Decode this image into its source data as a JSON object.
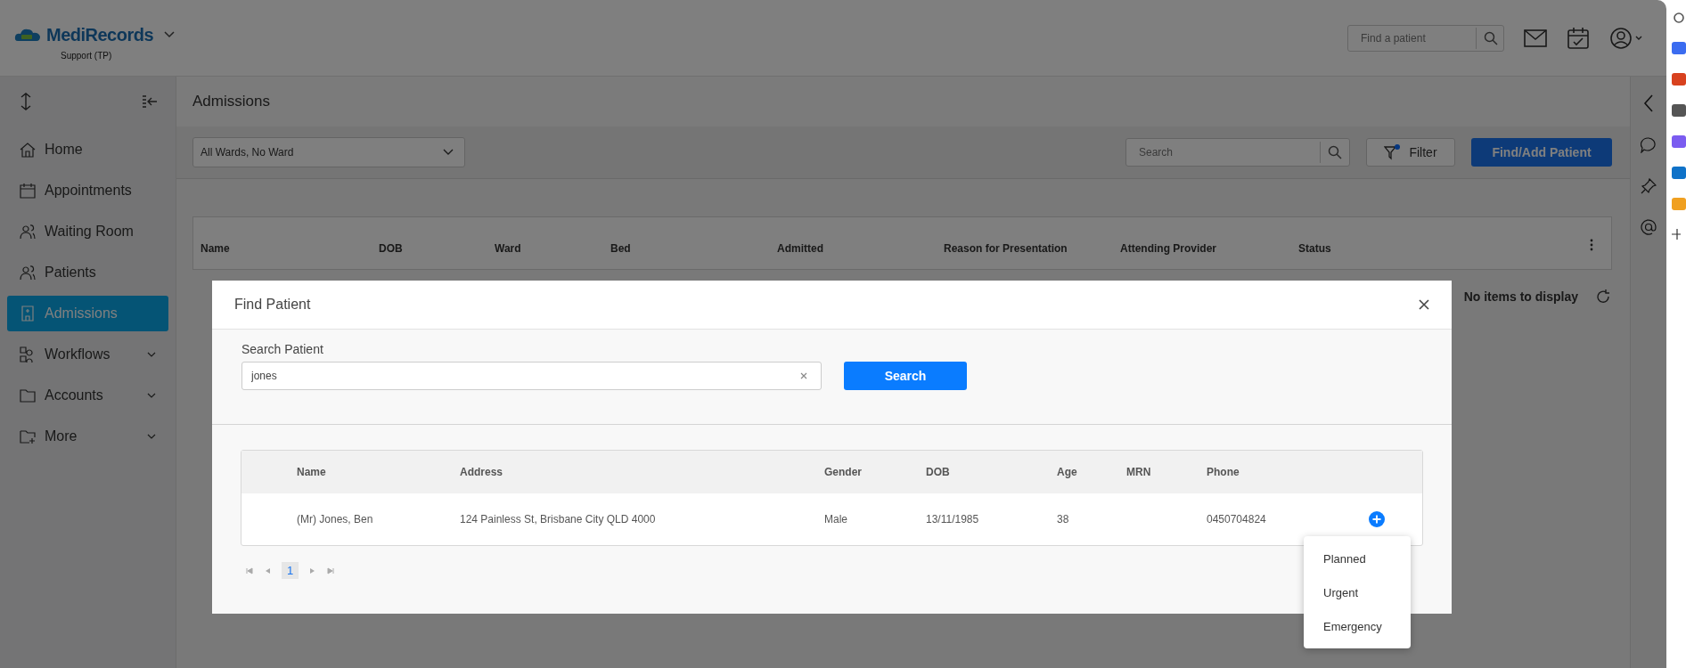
{
  "header": {
    "logo": "MediRecords",
    "subtitle": "Support (TP)",
    "search_placeholder": "Find a patient"
  },
  "sidebar": {
    "items": [
      {
        "label": "Home",
        "selected": false,
        "expandable": false
      },
      {
        "label": "Appointments",
        "selected": false,
        "expandable": false
      },
      {
        "label": "Waiting Room",
        "selected": false,
        "expandable": false
      },
      {
        "label": "Patients",
        "selected": false,
        "expandable": false
      },
      {
        "label": "Admissions",
        "selected": true,
        "expandable": false
      },
      {
        "label": "Workflows",
        "selected": false,
        "expandable": true
      },
      {
        "label": "Accounts",
        "selected": false,
        "expandable": true
      },
      {
        "label": "More",
        "selected": false,
        "expandable": true
      }
    ]
  },
  "page": {
    "title": "Admissions",
    "ward_select": "All Wards, No Ward",
    "search_placeholder": "Search",
    "filter": {
      "label": "Filter",
      "active": true
    },
    "primary_button": "Find/Add Patient",
    "table": {
      "columns": [
        "Name",
        "DOB",
        "Ward",
        "Bed",
        "Admitted",
        "Reason for Presentation",
        "Attending Provider",
        "Status"
      ],
      "empty_message": "No items to display"
    }
  },
  "modal": {
    "title": "Find Patient",
    "search_label": "Search Patient",
    "search_value": "jones",
    "search_button": "Search",
    "table": {
      "columns": [
        "Name",
        "Address",
        "Gender",
        "DOB",
        "Age",
        "MRN",
        "Phone"
      ],
      "rows": [
        {
          "cells": [
            "(Mr) Jones, Ben",
            "124 Painless St, Brisbane City QLD 4000",
            "Male",
            "13/11/1985",
            "38",
            "",
            "0450704824"
          ]
        }
      ]
    },
    "pager": {
      "pages": [
        {
          "label": "1",
          "selected": true
        }
      ]
    },
    "menu": [
      "Planned",
      "Urgent",
      "Emergency"
    ]
  }
}
